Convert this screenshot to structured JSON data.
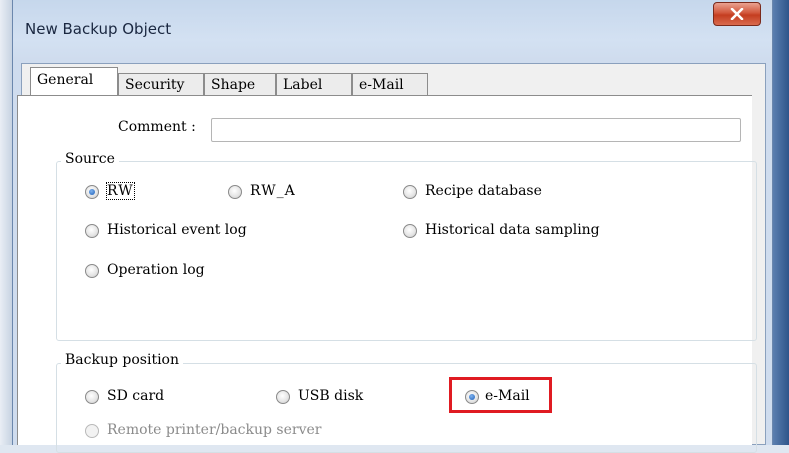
{
  "window": {
    "title": "New Backup Object"
  },
  "tabs": [
    {
      "label": "General",
      "active": true
    },
    {
      "label": "Security",
      "active": false
    },
    {
      "label": "Shape",
      "active": false
    },
    {
      "label": "Label",
      "active": false
    },
    {
      "label": "e-Mail",
      "active": false
    }
  ],
  "comment": {
    "label": "Comment :",
    "value": ""
  },
  "source": {
    "legend": "Source",
    "options": [
      {
        "label": "RW",
        "checked": true
      },
      {
        "label": "RW_A",
        "checked": false
      },
      {
        "label": "Recipe database",
        "checked": false
      },
      {
        "label": "Historical event log",
        "checked": false
      },
      {
        "label": "Historical data sampling",
        "checked": false
      },
      {
        "label": "Operation log",
        "checked": false
      }
    ]
  },
  "backup_position": {
    "legend": "Backup position",
    "options": [
      {
        "label": "SD card",
        "checked": false,
        "enabled": true
      },
      {
        "label": "USB disk",
        "checked": false,
        "enabled": true
      },
      {
        "label": "e-Mail",
        "checked": true,
        "enabled": true
      },
      {
        "label": "Remote printer/backup server",
        "checked": false,
        "enabled": false
      }
    ]
  },
  "colors": {
    "highlight": "#e01b22",
    "close_button": "#c43d20"
  },
  "icons": {
    "close": "close-icon"
  }
}
